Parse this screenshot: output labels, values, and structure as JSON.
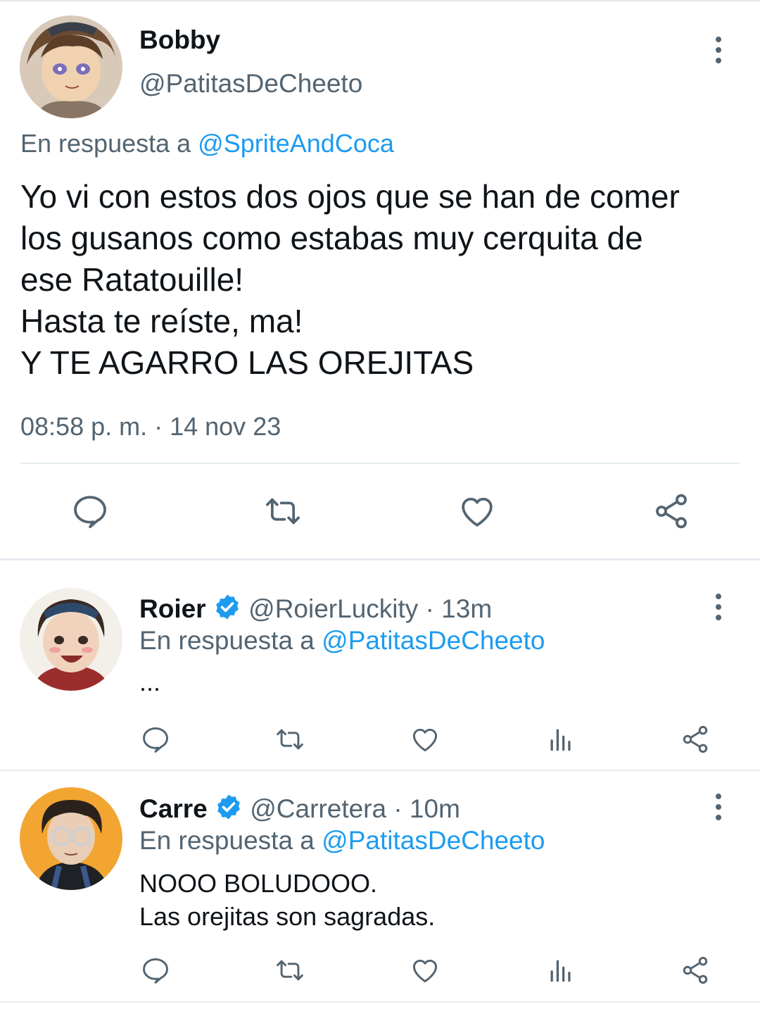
{
  "main_tweet": {
    "display_name": "Bobby",
    "handle": "@PatitasDeCheeto",
    "reply_prefix": "En respuesta a",
    "reply_to": "@SpriteAndCoca",
    "text_lines": [
      "Yo vi con estos dos ojos que se han de comer",
      "los gusanos como estabas muy cerquita de",
      "ese Ratatouille!",
      "Hasta te reíste, ma!",
      "Y TE AGARRO LAS OREJITAS"
    ],
    "timestamp": "08:58 p. m. · 14 nov 23",
    "actions": [
      "reply-icon",
      "retweet-icon",
      "like-icon",
      "share-icon"
    ]
  },
  "replies": [
    {
      "display_name": "Roier",
      "verified": true,
      "handle": "@RoierLuckity",
      "time": "· 13m",
      "reply_prefix": "En respuesta a",
      "reply_to": "@PatitasDeCheeto",
      "text_lines": [
        "..."
      ],
      "actions": [
        "reply-icon",
        "retweet-icon",
        "like-icon",
        "views-icon",
        "share-icon"
      ]
    },
    {
      "display_name": "Carre",
      "verified": true,
      "handle": "@Carretera",
      "time": "· 10m",
      "reply_prefix": "En respuesta a",
      "reply_to": "@PatitasDeCheeto",
      "text_lines": [
        "NOOO BOLUDOOO.",
        "Las orejitas son sagradas."
      ],
      "actions": [
        "reply-icon",
        "retweet-icon",
        "like-icon",
        "views-icon",
        "share-icon"
      ]
    }
  ],
  "colors": {
    "accent": "#1d9bf0",
    "secondary_text": "#536471",
    "primary_text": "#0f1419",
    "divider": "#e6ecf0"
  }
}
